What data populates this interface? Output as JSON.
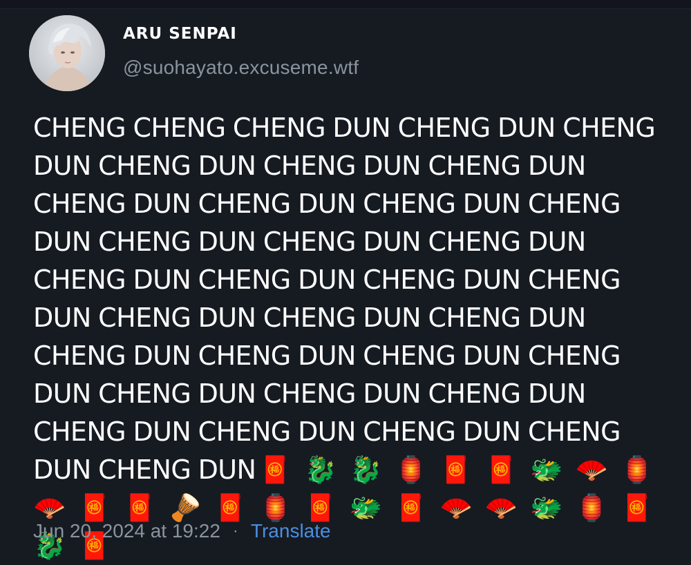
{
  "author": {
    "display_name": "ARU SENPAI",
    "handle": "@suohayato.excuseme.wtf"
  },
  "tweet": {
    "text": "CHENG CHENG CHENG DUN CHENG DUN CHENG DUN CHENG DUN CHENG DUN CHENG DUN CHENG DUN CHENG DUN CHENG DUN CHENG DUN CHENG DUN CHENG DUN CHENG DUN CHENG DUN CHENG DUN CHENG DUN CHENG DUN CHENG DUN CHENG DUN CHENG DUN CHENG DUN CHENG DUN CHENG DUN CHENG DUN CHENG DUN CHENG DUN CHENG DUN CHENG DUN CHENG DUN CHENG DUN CHENG DUN CHENG DUN",
    "emoji": "🧧 🐉 🐉 🏮 🧧 🧧 🐲 🪭 🏮 🪭 🧧 🧧 🪘 🧧 🏮 🧧 🐲 🧧 🪭 🪭 🐲 🏮 🧧 🐉 🧧"
  },
  "footer": {
    "timestamp": "Jun 20, 2024 at 19:22",
    "separator": "·",
    "translate_label": "Translate"
  },
  "colors": {
    "background": "#161b22",
    "text_primary": "#ffffff",
    "text_secondary": "#8b949e",
    "link": "#4a8fe3"
  }
}
